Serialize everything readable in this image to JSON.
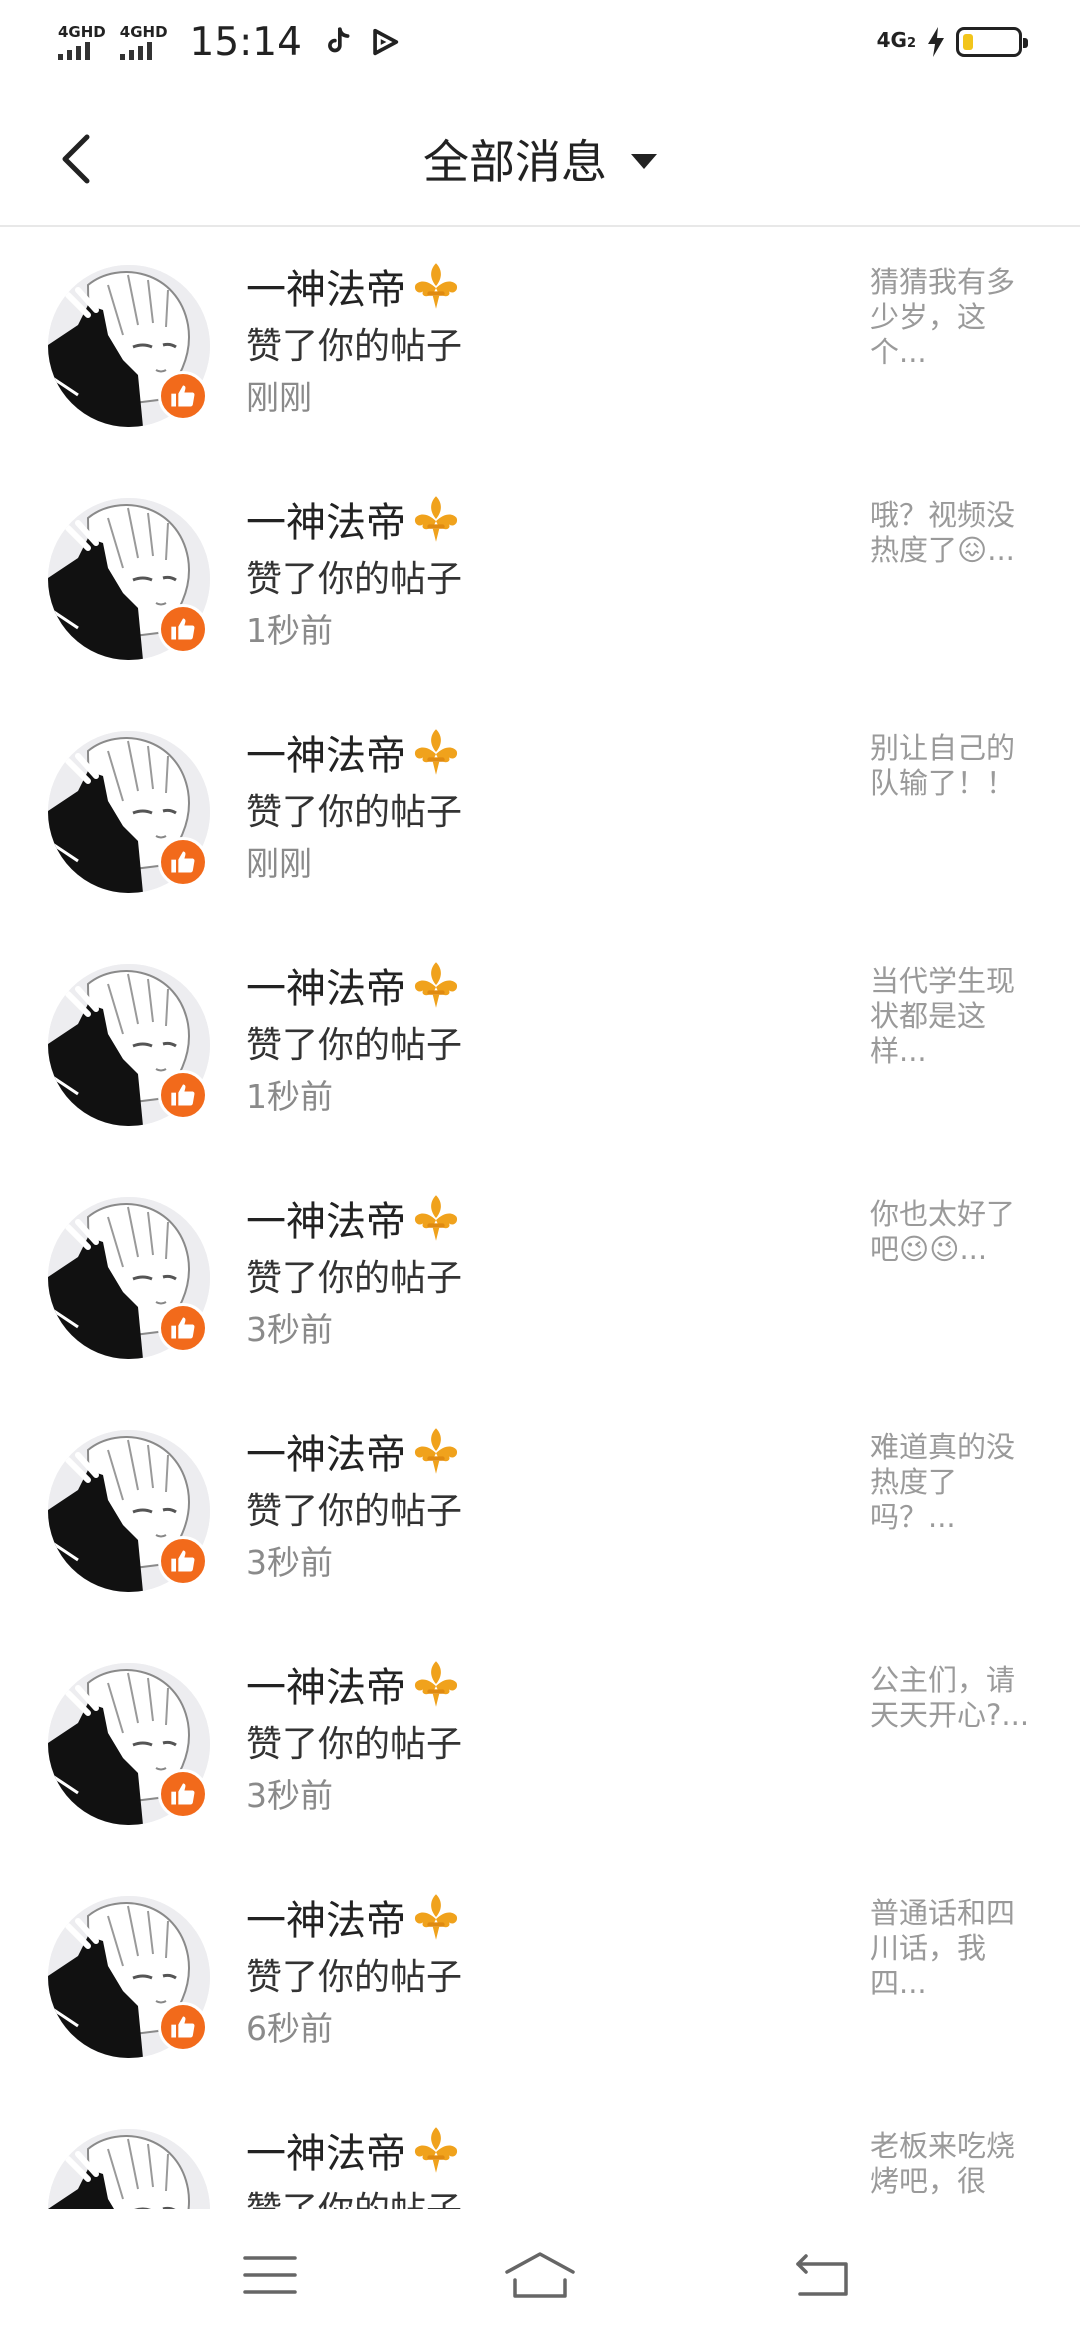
{
  "status_bar": {
    "signal1": "4GHD",
    "signal2": "4GHD",
    "time": "15:14",
    "network_right": "4G",
    "network_sub": "2",
    "icons": [
      "tiktok-icon",
      "play-icon",
      "charging-icon",
      "battery-icon"
    ],
    "battery_level": 0.15
  },
  "header": {
    "back_icon": "chevron-left-icon",
    "title": "全部消息",
    "dropdown_icon": "caret-down-icon"
  },
  "messages": [
    {
      "name": "一神法帝",
      "action": "赞了你的帖子",
      "time": "刚刚",
      "preview": "猜猜我有多少岁，这个..."
    },
    {
      "name": "一神法帝",
      "action": "赞了你的帖子",
      "time": "1秒前",
      "preview": "哦？视频没热度了😖..."
    },
    {
      "name": "一神法帝",
      "action": "赞了你的帖子",
      "time": "刚刚",
      "preview": "别让自己的队输了！！"
    },
    {
      "name": "一神法帝",
      "action": "赞了你的帖子",
      "time": "1秒前",
      "preview": "当代学生现状都是这样..."
    },
    {
      "name": "一神法帝",
      "action": "赞了你的帖子",
      "time": "3秒前",
      "preview": "你也太好了吧😉😉..."
    },
    {
      "name": "一神法帝",
      "action": "赞了你的帖子",
      "time": "3秒前",
      "preview": "难道真的没热度了吗？..."
    },
    {
      "name": "一神法帝",
      "action": "赞了你的帖子",
      "time": "3秒前",
      "preview": "公主们，请天天开心?..."
    },
    {
      "name": "一神法帝",
      "action": "赞了你的帖子",
      "time": "6秒前",
      "preview": "普通话和四川话，我四..."
    },
    {
      "name": "一神法帝",
      "action": "赞了你的帖子",
      "time": "",
      "preview": "老板来吃烧烤吧，很"
    }
  ],
  "colors": {
    "like_badge": "#f26a1b",
    "fleur_gold": "#f0a21c",
    "battery_fill": "#f2c51b"
  },
  "nav_bar": {
    "icons": [
      "menu-icon",
      "home-icon",
      "back-nav-icon"
    ]
  }
}
